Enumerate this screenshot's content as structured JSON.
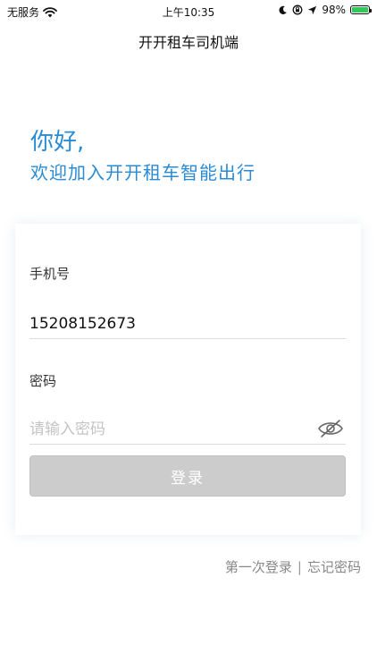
{
  "status_bar": {
    "carrier": "无服务",
    "time": "上午10:35",
    "battery": "98%",
    "battery_level": 0.98,
    "wifi_icon": "wifi-icon",
    "moon_icon": "moon-icon",
    "lock_icon": "rotation-lock-icon",
    "location_icon": "location-arrow-icon",
    "battery_icon": "battery-charging-icon"
  },
  "nav": {
    "title": "开开租车司机端"
  },
  "greeting": {
    "line1": "你好,",
    "line2": "欢迎加入开开租车智能出行"
  },
  "form": {
    "phone_label": "手机号",
    "phone_value": "15208152673",
    "password_label": "密码",
    "password_placeholder": "请输入密码",
    "eye_icon": "eye-hidden-icon",
    "login_label": "登录"
  },
  "links": {
    "first_login": "第一次登录",
    "separator": "|",
    "forgot_password": "忘记密码"
  },
  "colors": {
    "accent": "#2a8bd5",
    "button_disabled": "#cccccc",
    "battery_green": "#34c759"
  }
}
